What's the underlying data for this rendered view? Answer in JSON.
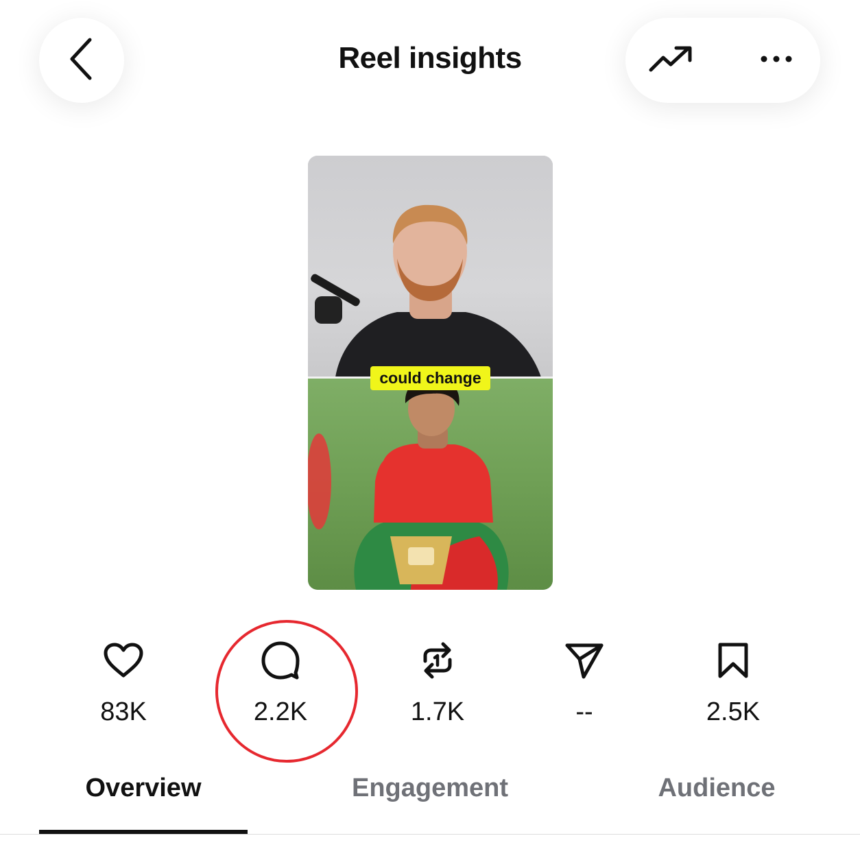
{
  "header": {
    "title": "Reel insights",
    "back_icon": "chevron-left-icon",
    "trend_icon": "trending-up-icon",
    "more_icon": "more-horizontal-icon"
  },
  "reel": {
    "caption": "could change",
    "caption_color": "#f0f51a"
  },
  "stats": [
    {
      "icon": "heart-icon",
      "value": "83K"
    },
    {
      "icon": "comment-icon",
      "value": "2.2K"
    },
    {
      "icon": "repost-icon",
      "value": "1.7K"
    },
    {
      "icon": "send-icon",
      "value": "--"
    },
    {
      "icon": "bookmark-icon",
      "value": "2.5K"
    }
  ],
  "highlight_color": "#e6282f",
  "tabs": [
    {
      "label": "Overview",
      "active": true
    },
    {
      "label": "Engagement",
      "active": false
    },
    {
      "label": "Audience",
      "active": false
    }
  ]
}
